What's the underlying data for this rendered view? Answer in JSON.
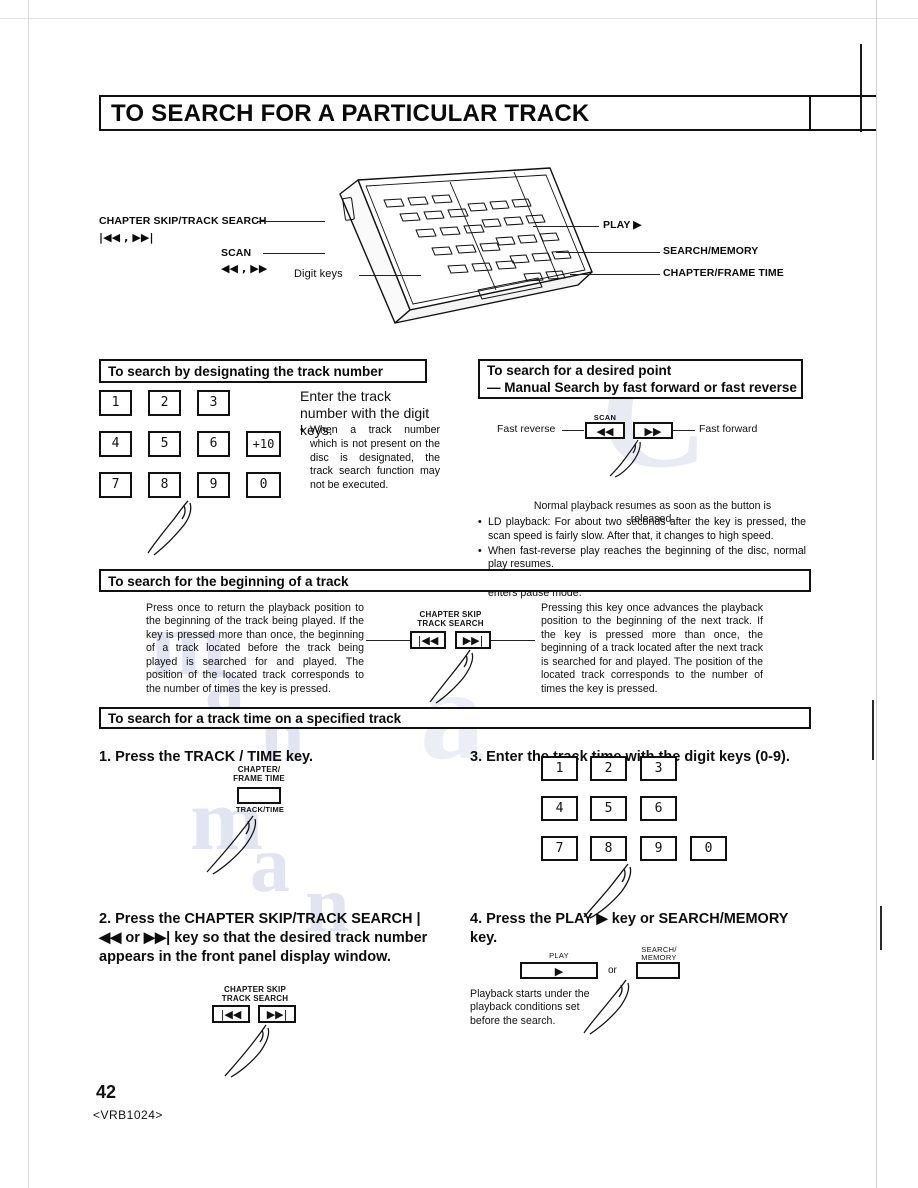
{
  "page": {
    "title": "TO SEARCH FOR A PARTICULAR TRACK",
    "number": "42",
    "code": "<VRB1024>"
  },
  "remote_callouts": {
    "chapter_skip": "CHAPTER SKIP/TRACK SEARCH",
    "chapter_skip_sym": "|◀◀ , ▶▶|",
    "scan": "SCAN",
    "scan_sym": "◀◀ , ▶▶",
    "digit_keys": "Digit keys",
    "play": "PLAY ▶",
    "search_memory": "SEARCH/MEMORY",
    "chapter_frame_time": "CHAPTER/FRAME TIME"
  },
  "section_track_number": {
    "heading": "To search by designating the track number",
    "keys": [
      "1",
      "2",
      "3",
      "4",
      "5",
      "6",
      "+10",
      "7",
      "8",
      "9",
      "0"
    ],
    "lead": "Enter the track number with the digit keys.",
    "bullets": [
      "When a track number which is not present on the disc is designated, the track search function may not be executed."
    ]
  },
  "section_desired_point": {
    "heading_line1": "To search for a desired point",
    "heading_line2": "— Manual Search by fast forward or fast reverse",
    "scan_label": "SCAN",
    "fast_reverse": "Fast reverse",
    "fast_forward": "Fast forward",
    "rev_button": "◀◀",
    "fwd_button": "▶▶",
    "note": "Normal playback resumes as soon as the button is released.",
    "bullets": [
      "LD playback: For about two seconds after the key is pressed, the scan speed is fairly slow. After that, it changes to high speed.",
      "When fast-reverse play reaches the beginning of the disc, normal play resumes.",
      "When fast-forward play reaches the end of the dis, and the unit enters pause mode."
    ]
  },
  "section_beginning": {
    "heading": "To search for the beginning of a track",
    "left_text": "Press once to return the playback position to the beginning of the track being played. If the key is pressed more than once, the beginning of a track located before the track being played is searched for and played. The position of the located track corresponds to the number of times the key is pressed.",
    "right_text": "Pressing this key once advances the playback position to the beginning of the next track. If the key is pressed more than once, the beginning of a track located after the next track is searched for and played. The position of the located track corresponds to the number of times the key is pressed.",
    "button_label_line1": "CHAPTER SKIP",
    "button_label_line2": "TRACK SEARCH",
    "prev_button": "|◀◀",
    "next_button": "▶▶|"
  },
  "section_track_time": {
    "heading": "To search for a track time on a specified track",
    "step1": {
      "text": "1. Press the TRACK / TIME key.",
      "button_top_line1": "CHAPTER/",
      "button_top_line2": "FRAME TIME",
      "button_bottom": "TRACK/TIME"
    },
    "step2": {
      "text": "2. Press the CHAPTER SKIP/TRACK SEARCH |◀◀ or ▶▶| key so that the desired track number appears in the front panel display window.",
      "button_label_line1": "CHAPTER SKIP",
      "button_label_line2": "TRACK SEARCH",
      "prev_button": "|◀◀",
      "next_button": "▶▶|"
    },
    "step3": {
      "text": "3. Enter the track time with the digit keys (0-9).",
      "keys": [
        "1",
        "2",
        "3",
        "4",
        "5",
        "6",
        "7",
        "8",
        "9",
        "0"
      ]
    },
    "step4": {
      "text": "4. Press the PLAY ▶ key or SEARCH/MEMORY key.",
      "play_label": "PLAY",
      "play_glyph": "▶",
      "or_label": "or",
      "search_label_line1": "SEARCH/",
      "search_label_line2": "MEMORY",
      "note": "Playback starts under the playback conditions set before the search."
    }
  }
}
